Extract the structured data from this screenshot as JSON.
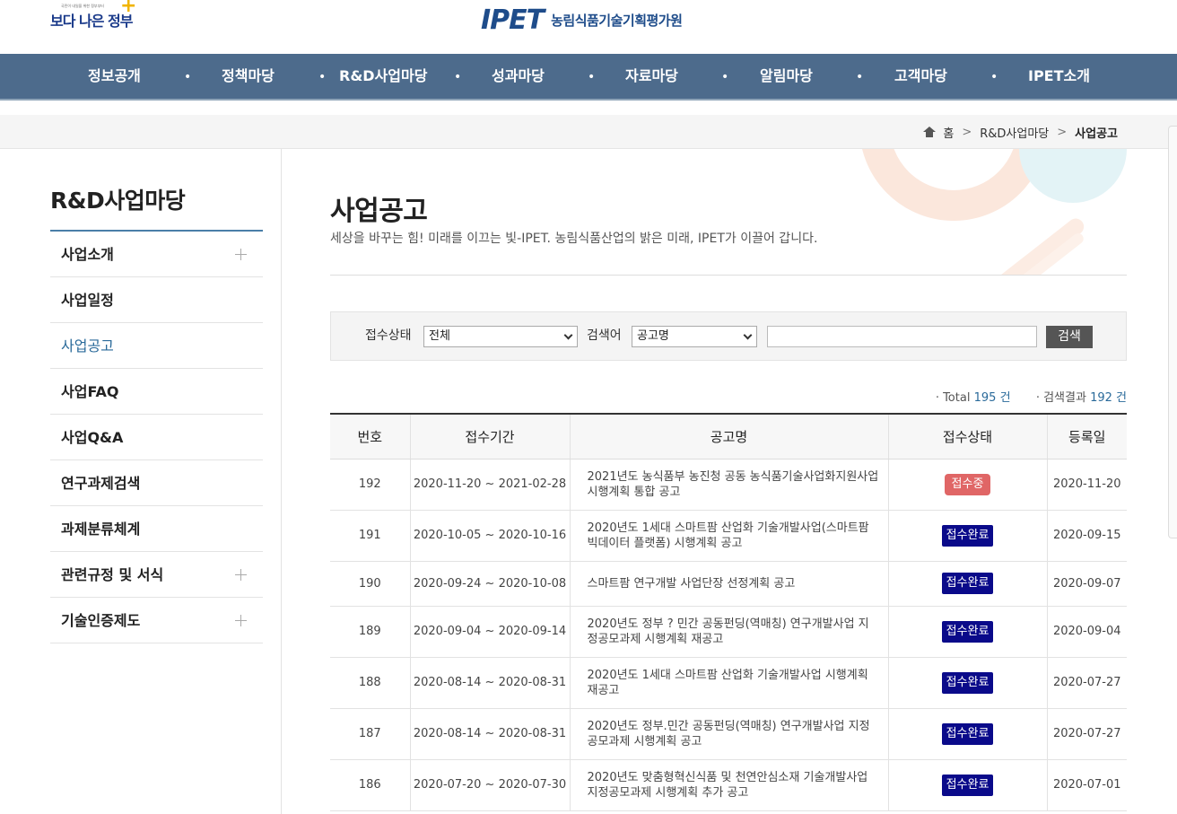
{
  "header": {
    "gov_logo_small": "국민이 내일을 위한 정부부터",
    "gov_logo_text": "보다 나은 정부",
    "ipet_mark": "IPET",
    "org_name": "농림식품기술기획평가원"
  },
  "gnb": {
    "items": [
      "정보공개",
      "정책마당",
      "R&D사업마당",
      "성과마당",
      "자료마당",
      "알림마당",
      "고객마당",
      "IPET소개"
    ]
  },
  "breadcrumb": {
    "home": "홈",
    "level1": "R&D사업마당",
    "current": "사업공고"
  },
  "lnb": {
    "title": "R&D사업마당",
    "items": [
      {
        "label": "사업소개",
        "expandable": true
      },
      {
        "label": "사업일정",
        "expandable": false
      },
      {
        "label": "사업공고",
        "expandable": false,
        "active": true
      },
      {
        "label": "사업FAQ",
        "expandable": false
      },
      {
        "label": "사업Q&A",
        "expandable": false
      },
      {
        "label": "연구과제검색",
        "expandable": false
      },
      {
        "label": "과제분류체계",
        "expandable": false
      },
      {
        "label": "관련규정 및 서식",
        "expandable": true
      },
      {
        "label": "기술인증제도",
        "expandable": true
      }
    ]
  },
  "page": {
    "title": "사업공고",
    "description": "세상을 바꾸는 힘! 미래를 이끄는 빛-IPET. 농림식품산업의 밝은 미래, IPET가 이끌어 갑니다."
  },
  "search": {
    "status_label": "접수상태",
    "status_value": "전체",
    "keyword_label": "검색어",
    "keyword_type_value": "공고명",
    "keyword_value": "",
    "button_label": "검색"
  },
  "totals": {
    "total_prefix": "· Total",
    "total_count": "195",
    "total_unit": "건",
    "result_prefix": "· 검색결과",
    "result_count": "192",
    "result_unit": "건"
  },
  "table": {
    "headers": [
      "번호",
      "접수기간",
      "공고명",
      "접수상태",
      "등록일"
    ],
    "rows": [
      {
        "no": "192",
        "period": "2020-11-20 ~ 2021-02-28",
        "title": "2021년도 농식품부 농진청 공동 농식품기술사업화지원사업 시행계획 통합 공고",
        "status": "접수중",
        "status_type": "open",
        "date": "2020-11-20"
      },
      {
        "no": "191",
        "period": "2020-10-05 ~ 2020-10-16",
        "title": "2020년도 1세대 스마트팜 산업화 기술개발사업(스마트팜 빅데이터 플랫폼) 시행계획 공고",
        "status": "접수완료",
        "status_type": "closed",
        "date": "2020-09-15"
      },
      {
        "no": "190",
        "period": "2020-09-24 ~ 2020-10-08",
        "title": "스마트팜 연구개발 사업단장 선정계획 공고",
        "status": "접수완료",
        "status_type": "closed",
        "date": "2020-09-07"
      },
      {
        "no": "189",
        "period": "2020-09-04 ~ 2020-09-14",
        "title": "2020년도 정부 ? 민간 공동펀딩(역매칭) 연구개발사업 지정공모과제 시행계획 재공고",
        "status": "접수완료",
        "status_type": "closed",
        "date": "2020-09-04"
      },
      {
        "no": "188",
        "period": "2020-08-14 ~ 2020-08-31",
        "title": "2020년도 1세대 스마트팜 산업화 기술개발사업 시행계획 재공고",
        "status": "접수완료",
        "status_type": "closed",
        "date": "2020-07-27"
      },
      {
        "no": "187",
        "period": "2020-08-14 ~ 2020-08-31",
        "title": "2020년도 정부.민간 공동펀딩(역매칭) 연구개발사업 지정공모과제 시행계획 공고",
        "status": "접수완료",
        "status_type": "closed",
        "date": "2020-07-27"
      },
      {
        "no": "186",
        "period": "2020-07-20 ~ 2020-07-30",
        "title": "2020년도 맞춤형혁신식품 및 천연안심소재 기술개발사업 지정공모과제 시행계획 추가 공고",
        "status": "접수완료",
        "status_type": "closed",
        "date": "2020-07-01"
      }
    ]
  },
  "colors": {
    "gnb_bg": "#4d6b8c",
    "accent": "#2a6a9a",
    "badge_open": "#e06666",
    "badge_closed": "#0a0a8a"
  }
}
